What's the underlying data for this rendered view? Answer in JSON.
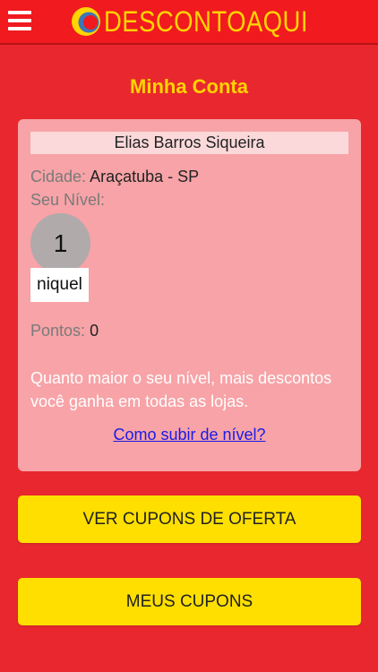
{
  "header": {
    "brand": "DESCONTOAQUI",
    "colors": {
      "bar": "#F01A1F",
      "brand_text": "#FFD400"
    },
    "menu_icon": "hamburger-icon"
  },
  "page": {
    "title": "Minha Conta",
    "background": "#E8282E"
  },
  "account": {
    "name": "Elias Barros Siqueira",
    "city_label": "Cidade:",
    "city_value": "Araçatuba - SP",
    "level_label": "Seu Nível:",
    "level_number": "1",
    "level_name": "niquel",
    "points_label": "Pontos:",
    "points_value": "0",
    "info_text": "Quanto maior o seu nível, mais descontos você ganha em todas as lojas.",
    "help_link": "Como subir de nível?"
  },
  "buttons": {
    "offers": "VER CUPONS DE OFERTA",
    "my_coupons": "MEUS CUPONS",
    "color": "#FFDF00"
  }
}
